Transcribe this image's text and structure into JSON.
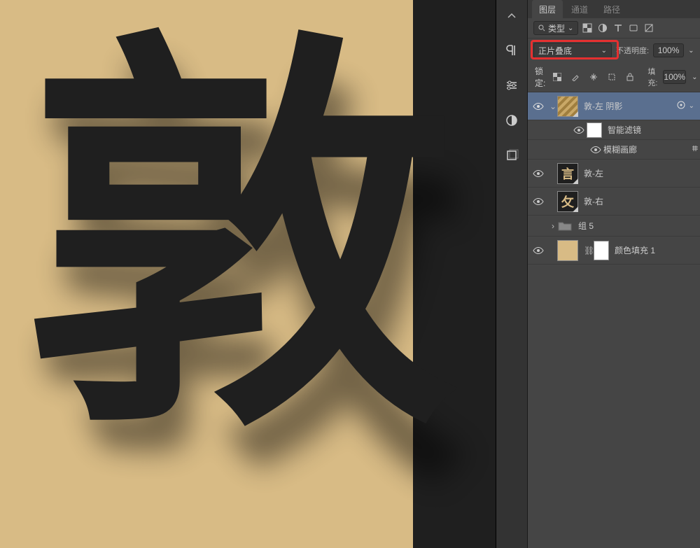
{
  "tabs": {
    "layers": "图层",
    "channels": "通道",
    "paths": "路径"
  },
  "filter": {
    "label": "类型"
  },
  "blend": {
    "mode": "正片叠底",
    "opacity_label": "不透明度:",
    "opacity_value": "100%"
  },
  "lock": {
    "label": "锁定:",
    "fill_label": "填充:",
    "fill_value": "100%"
  },
  "layers": {
    "l0": "敦-左 阴影",
    "l0_sf": "智能滤镜",
    "l0_sf_item": "模糊画廊",
    "l1": "敦-左",
    "l2": "敦-右",
    "grp": "组 5",
    "fill": "颜色填充 1"
  },
  "canvas_char": "敦"
}
